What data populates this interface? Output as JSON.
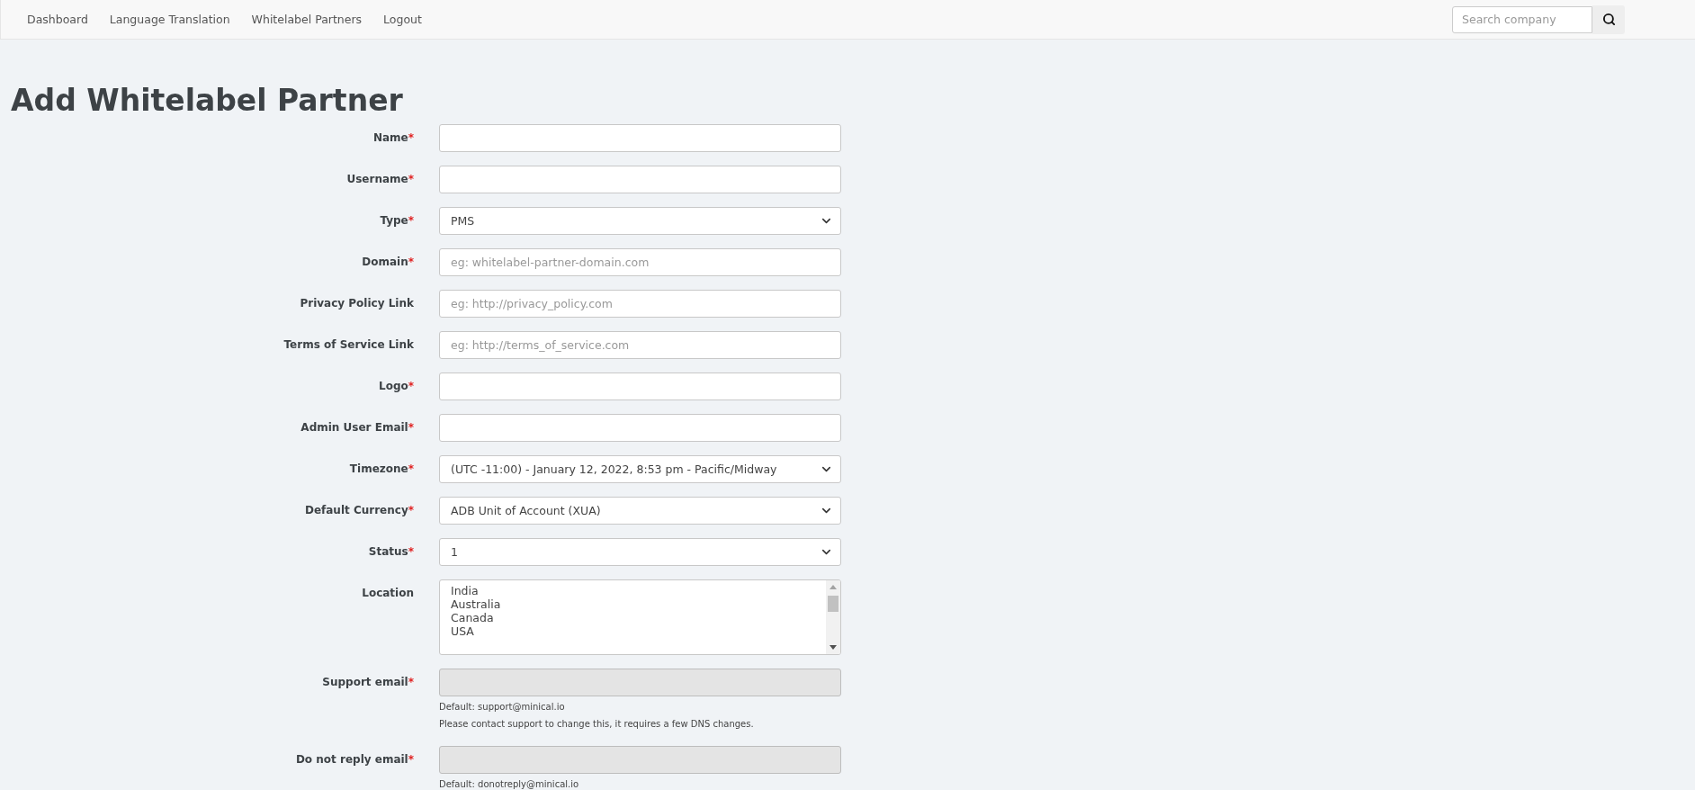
{
  "navbar": {
    "links": [
      {
        "label": "Dashboard"
      },
      {
        "label": "Language Translation"
      },
      {
        "label": "Whitelabel Partners"
      },
      {
        "label": "Logout"
      }
    ],
    "search": {
      "placeholder": "Search company"
    }
  },
  "page": {
    "title": "Add Whitelabel Partner"
  },
  "form": {
    "fields": [
      {
        "kind": "text",
        "label": "Name",
        "required_mark": "*",
        "disabled": false
      },
      {
        "kind": "text",
        "label": "Username",
        "required_mark": "*",
        "disabled": false
      },
      {
        "kind": "select",
        "label": "Type",
        "required_mark": "*",
        "value": "PMS"
      },
      {
        "kind": "text",
        "label": "Domain",
        "required_mark": "*",
        "disabled": false,
        "placeholder": "eg: whitelabel-partner-domain.com"
      },
      {
        "kind": "text",
        "label": "Privacy Policy Link",
        "disabled": false,
        "placeholder": "eg: http://privacy_policy.com"
      },
      {
        "kind": "text",
        "label": "Terms of Service Link",
        "disabled": false,
        "placeholder": "eg: http://terms_of_service.com"
      },
      {
        "kind": "text",
        "label": "Logo",
        "required_mark": "*",
        "disabled": false
      },
      {
        "kind": "text",
        "label": "Admin User Email",
        "required_mark": "*",
        "disabled": false
      },
      {
        "kind": "select",
        "label": "Timezone",
        "required_mark": "*",
        "value": "(UTC -11:00) - January 12, 2022, 8:53 pm - Pacific/Midway"
      },
      {
        "kind": "select",
        "label": "Default Currency",
        "required_mark": "*",
        "value": "ADB Unit of Account (XUA)"
      },
      {
        "kind": "select",
        "label": "Status",
        "required_mark": "*",
        "value": "1"
      },
      {
        "kind": "listbox",
        "label": "Location",
        "options": [
          "India",
          "Australia",
          "Canada",
          "USA"
        ]
      },
      {
        "kind": "text",
        "label": "Support email",
        "required_mark": "*",
        "disabled": true,
        "help": [
          "Default: support@minical.io",
          "Please contact support to change this, it requires a few DNS changes."
        ]
      },
      {
        "kind": "text",
        "label": "Do not reply email",
        "required_mark": "*",
        "disabled": true,
        "help": [
          "Default: donotreply@minical.io"
        ]
      }
    ]
  }
}
